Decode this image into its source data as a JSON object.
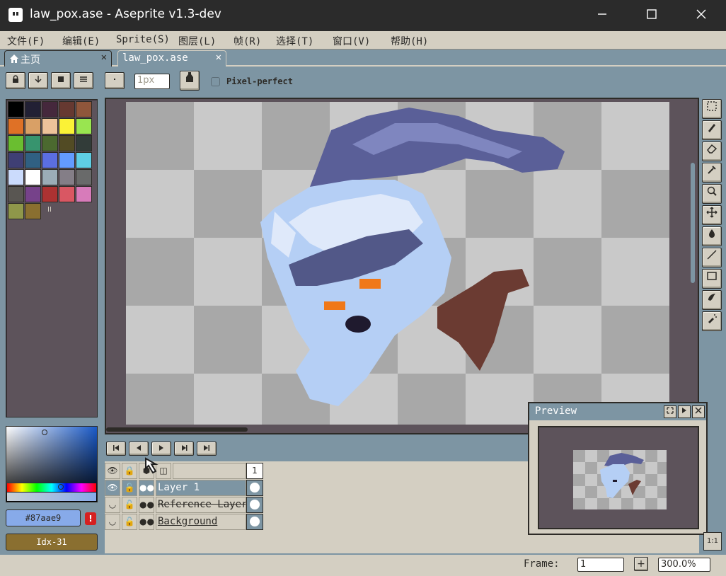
{
  "window": {
    "title": "law_pox.ase - Aseprite v1.3-dev",
    "minimize_icon": "minimize-icon",
    "maximize_icon": "maximize-icon",
    "close_icon": "close-icon"
  },
  "menu": [
    "文件(F)",
    "编辑(E)",
    "Sprite(S)",
    "图层(L)",
    "帧(R)",
    "选择(T)",
    "窗口(V)",
    "帮助(H)"
  ],
  "tabs": [
    {
      "label": "主页",
      "icon": "home-icon",
      "active": false
    },
    {
      "label": "law_pox.ase",
      "active": true
    }
  ],
  "context": {
    "brush_size": "1px",
    "pixel_perfect_label": "Pixel-perfect",
    "pixel_perfect_checked": false
  },
  "palette": {
    "colors": [
      "#000000",
      "#222034",
      "#45283c",
      "#663931",
      "#8f563b",
      "#df7126",
      "#d9a066",
      "#eec39a",
      "#fbf236",
      "#99e550",
      "#6abe30",
      "#37946e",
      "#4b692f",
      "#524b24",
      "#323c39",
      "#3f3f74",
      "#306082",
      "#5b6ee1",
      "#639bff",
      "#5fcde4",
      "#cbdbfc",
      "#ffffff",
      "#9badb7",
      "#847e87",
      "#696a6a",
      "#595652",
      "#76428a",
      "#ac3232",
      "#d95763",
      "#d77bba",
      "#8f974a",
      "#8a6f30"
    ],
    "menu_glyph": "II"
  },
  "color": {
    "hex": "#87aae9",
    "warning_icon": "warning-icon",
    "index_label": "Idx-31",
    "current": "#87aae9"
  },
  "tools": [
    "marquee-icon",
    "pencil-icon",
    "eraser-icon",
    "eyedropper-icon",
    "zoom-icon",
    "move-icon",
    "fill-icon",
    "line-icon",
    "rectangle-icon",
    "blur-icon",
    "spray-icon"
  ],
  "timeline": {
    "frame_header": "1",
    "layers": [
      {
        "name": "Layer 1",
        "visible": true,
        "struck": false,
        "selected": true
      },
      {
        "name": "Reference Layer",
        "visible": false,
        "struck": true,
        "selected": false
      },
      {
        "name": "Background",
        "visible": false,
        "struck": false,
        "selected": false
      }
    ]
  },
  "status": {
    "frame_label": "Frame:",
    "frame_value": "1",
    "add_frame": "+",
    "zoom": "300.0%"
  },
  "preview": {
    "title": "Preview",
    "ratio_label": "1:1"
  }
}
